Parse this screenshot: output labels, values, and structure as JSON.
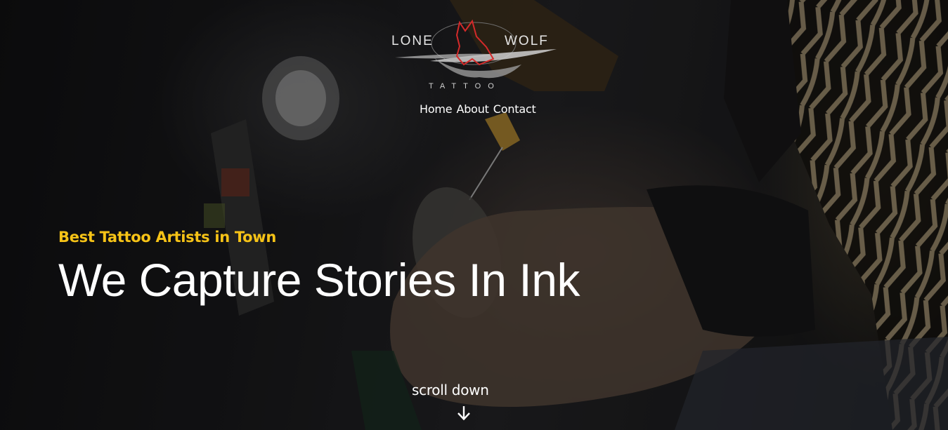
{
  "brand": {
    "logo_left_word": "LONE",
    "logo_right_word": "WOLF",
    "logo_sub_word": "TATTOO"
  },
  "nav": {
    "items": [
      {
        "label": "Home"
      },
      {
        "label": "About"
      },
      {
        "label": "Contact"
      }
    ]
  },
  "hero": {
    "eyebrow": "Best Tattoo Artists in Town",
    "headline": "We Capture Stories In Ink",
    "scroll_label": "scroll down",
    "scroll_icon": "arrow-down-icon"
  },
  "colors": {
    "accent": "#f6c317",
    "text": "#ffffff",
    "logo_red": "#d42a2a"
  }
}
